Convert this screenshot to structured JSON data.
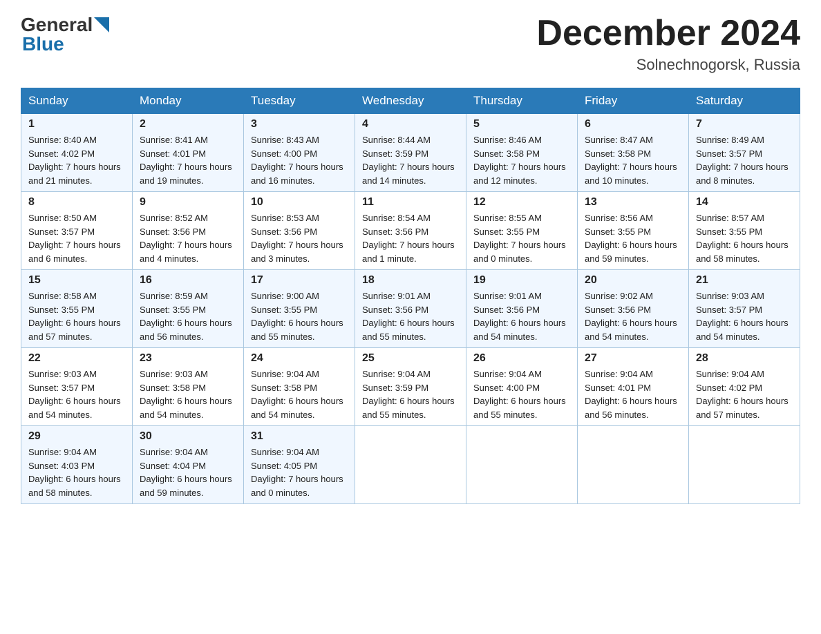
{
  "header": {
    "logo_general": "General",
    "logo_blue": "Blue",
    "month_title": "December 2024",
    "location": "Solnechnogorsk, Russia"
  },
  "days_of_week": [
    "Sunday",
    "Monday",
    "Tuesday",
    "Wednesday",
    "Thursday",
    "Friday",
    "Saturday"
  ],
  "weeks": [
    [
      {
        "day": "1",
        "sunrise": "8:40 AM",
        "sunset": "4:02 PM",
        "daylight": "7 hours and 21 minutes."
      },
      {
        "day": "2",
        "sunrise": "8:41 AM",
        "sunset": "4:01 PM",
        "daylight": "7 hours and 19 minutes."
      },
      {
        "day": "3",
        "sunrise": "8:43 AM",
        "sunset": "4:00 PM",
        "daylight": "7 hours and 16 minutes."
      },
      {
        "day": "4",
        "sunrise": "8:44 AM",
        "sunset": "3:59 PM",
        "daylight": "7 hours and 14 minutes."
      },
      {
        "day": "5",
        "sunrise": "8:46 AM",
        "sunset": "3:58 PM",
        "daylight": "7 hours and 12 minutes."
      },
      {
        "day": "6",
        "sunrise": "8:47 AM",
        "sunset": "3:58 PM",
        "daylight": "7 hours and 10 minutes."
      },
      {
        "day": "7",
        "sunrise": "8:49 AM",
        "sunset": "3:57 PM",
        "daylight": "7 hours and 8 minutes."
      }
    ],
    [
      {
        "day": "8",
        "sunrise": "8:50 AM",
        "sunset": "3:57 PM",
        "daylight": "7 hours and 6 minutes."
      },
      {
        "day": "9",
        "sunrise": "8:52 AM",
        "sunset": "3:56 PM",
        "daylight": "7 hours and 4 minutes."
      },
      {
        "day": "10",
        "sunrise": "8:53 AM",
        "sunset": "3:56 PM",
        "daylight": "7 hours and 3 minutes."
      },
      {
        "day": "11",
        "sunrise": "8:54 AM",
        "sunset": "3:56 PM",
        "daylight": "7 hours and 1 minute."
      },
      {
        "day": "12",
        "sunrise": "8:55 AM",
        "sunset": "3:55 PM",
        "daylight": "7 hours and 0 minutes."
      },
      {
        "day": "13",
        "sunrise": "8:56 AM",
        "sunset": "3:55 PM",
        "daylight": "6 hours and 59 minutes."
      },
      {
        "day": "14",
        "sunrise": "8:57 AM",
        "sunset": "3:55 PM",
        "daylight": "6 hours and 58 minutes."
      }
    ],
    [
      {
        "day": "15",
        "sunrise": "8:58 AM",
        "sunset": "3:55 PM",
        "daylight": "6 hours and 57 minutes."
      },
      {
        "day": "16",
        "sunrise": "8:59 AM",
        "sunset": "3:55 PM",
        "daylight": "6 hours and 56 minutes."
      },
      {
        "day": "17",
        "sunrise": "9:00 AM",
        "sunset": "3:55 PM",
        "daylight": "6 hours and 55 minutes."
      },
      {
        "day": "18",
        "sunrise": "9:01 AM",
        "sunset": "3:56 PM",
        "daylight": "6 hours and 55 minutes."
      },
      {
        "day": "19",
        "sunrise": "9:01 AM",
        "sunset": "3:56 PM",
        "daylight": "6 hours and 54 minutes."
      },
      {
        "day": "20",
        "sunrise": "9:02 AM",
        "sunset": "3:56 PM",
        "daylight": "6 hours and 54 minutes."
      },
      {
        "day": "21",
        "sunrise": "9:03 AM",
        "sunset": "3:57 PM",
        "daylight": "6 hours and 54 minutes."
      }
    ],
    [
      {
        "day": "22",
        "sunrise": "9:03 AM",
        "sunset": "3:57 PM",
        "daylight": "6 hours and 54 minutes."
      },
      {
        "day": "23",
        "sunrise": "9:03 AM",
        "sunset": "3:58 PM",
        "daylight": "6 hours and 54 minutes."
      },
      {
        "day": "24",
        "sunrise": "9:04 AM",
        "sunset": "3:58 PM",
        "daylight": "6 hours and 54 minutes."
      },
      {
        "day": "25",
        "sunrise": "9:04 AM",
        "sunset": "3:59 PM",
        "daylight": "6 hours and 55 minutes."
      },
      {
        "day": "26",
        "sunrise": "9:04 AM",
        "sunset": "4:00 PM",
        "daylight": "6 hours and 55 minutes."
      },
      {
        "day": "27",
        "sunrise": "9:04 AM",
        "sunset": "4:01 PM",
        "daylight": "6 hours and 56 minutes."
      },
      {
        "day": "28",
        "sunrise": "9:04 AM",
        "sunset": "4:02 PM",
        "daylight": "6 hours and 57 minutes."
      }
    ],
    [
      {
        "day": "29",
        "sunrise": "9:04 AM",
        "sunset": "4:03 PM",
        "daylight": "6 hours and 58 minutes."
      },
      {
        "day": "30",
        "sunrise": "9:04 AM",
        "sunset": "4:04 PM",
        "daylight": "6 hours and 59 minutes."
      },
      {
        "day": "31",
        "sunrise": "9:04 AM",
        "sunset": "4:05 PM",
        "daylight": "7 hours and 0 minutes."
      },
      null,
      null,
      null,
      null
    ]
  ],
  "labels": {
    "sunrise_prefix": "Sunrise: ",
    "sunset_prefix": "Sunset: ",
    "daylight_prefix": "Daylight: "
  }
}
